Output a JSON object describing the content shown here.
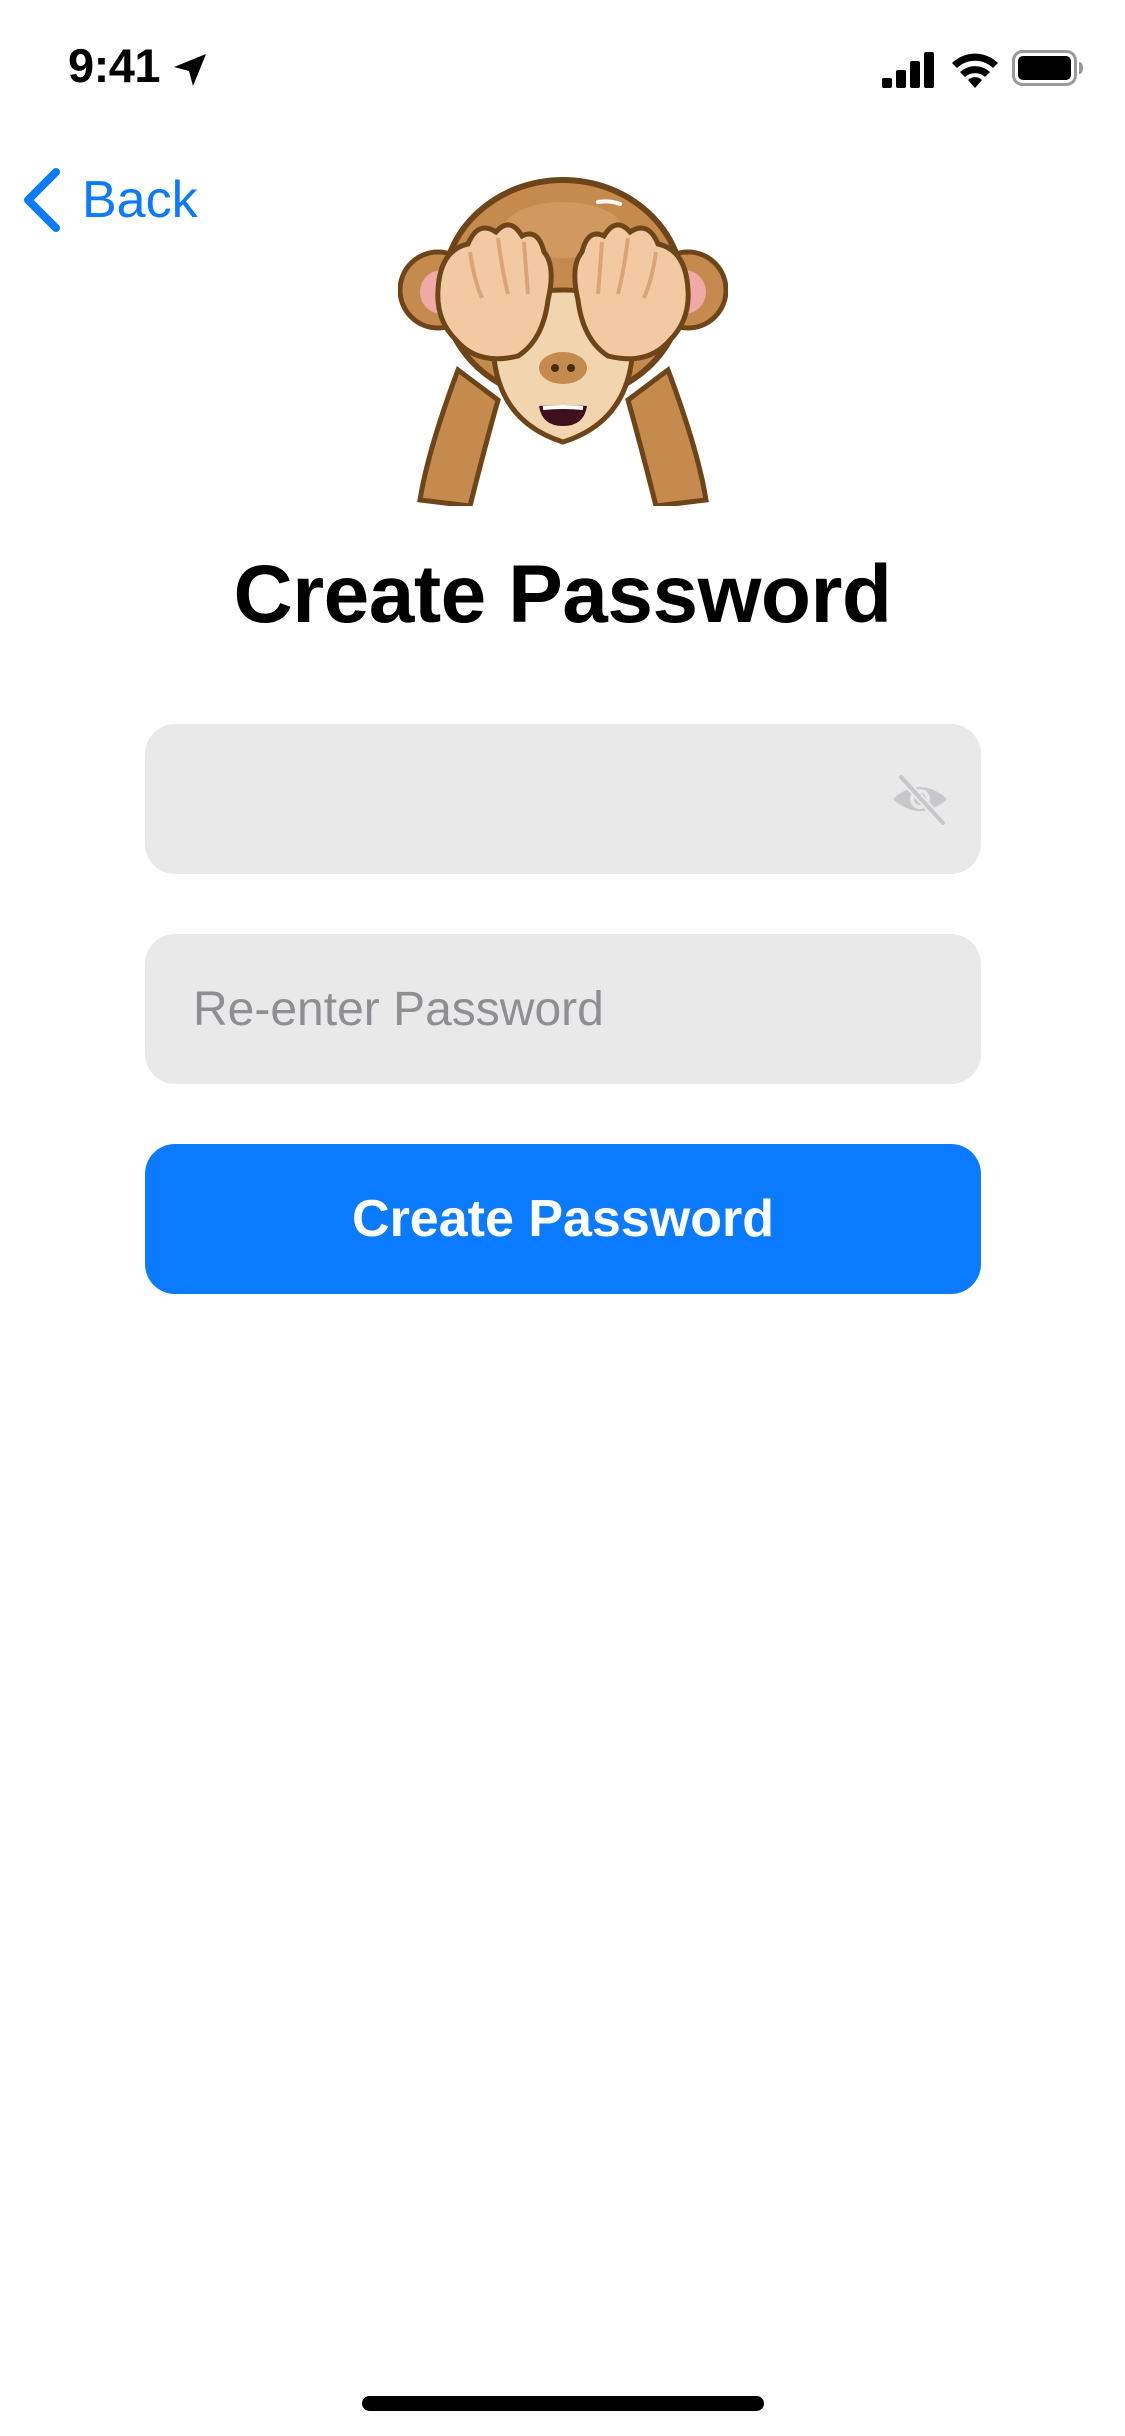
{
  "status_bar": {
    "time": "9:41"
  },
  "nav": {
    "back_label": "Back"
  },
  "header": {
    "emoji": "see-no-evil-monkey",
    "title": "Create Password"
  },
  "form": {
    "password": {
      "value": "",
      "placeholder": ""
    },
    "reenter_password": {
      "value": "",
      "placeholder": "Re-enter Password"
    },
    "submit_label": "Create Password"
  },
  "colors": {
    "accent": "#0A7AFF",
    "field_background": "#E9E9EA",
    "placeholder": "#8E8E93"
  },
  "icons": {
    "back": "chevron-left-icon",
    "visibility_toggle": "eye-slash-icon",
    "location": "location-arrow-icon",
    "signal": "cellular-signal-icon",
    "wifi": "wifi-icon",
    "battery": "battery-icon"
  }
}
